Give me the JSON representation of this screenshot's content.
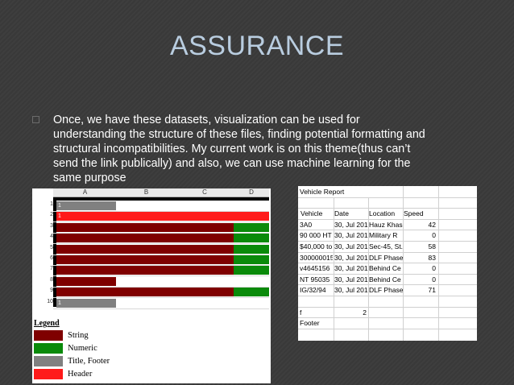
{
  "slide": {
    "title": "ASSURANCE",
    "bullet": "Once, we have these datasets, visualization can be used for understanding the structure of these files, finding potential formatting and structural incompatibilities. My current work is on this theme(thus can’t send the link publically) and also, we can use machine learning for the same purpose"
  },
  "sheet": {
    "columns": [
      "A",
      "B",
      "C",
      "D"
    ],
    "rows": [
      {
        "num": "1",
        "cell": "1",
        "type": "title"
      },
      {
        "num": "2",
        "cell": "1",
        "type": "header"
      },
      {
        "num": "3",
        "cell": "",
        "type": "string-numeric"
      },
      {
        "num": "4",
        "cell": "",
        "type": "string-numeric"
      },
      {
        "num": "5",
        "cell": "",
        "type": "string-numeric"
      },
      {
        "num": "6",
        "cell": "",
        "type": "string-numeric"
      },
      {
        "num": "7",
        "cell": "",
        "type": "string-numeric"
      },
      {
        "num": "8",
        "cell": "",
        "type": "string-short"
      },
      {
        "num": "9",
        "cell": "",
        "type": "string-numeric"
      },
      {
        "num": "10",
        "cell": "1",
        "type": "title"
      }
    ],
    "legend": {
      "title": "Legend",
      "items": [
        {
          "label": "String",
          "color": "#7f0000"
        },
        {
          "label": "Numeric",
          "color": "#0a8a0a"
        },
        {
          "label": "Title, Footer",
          "color": "#808080"
        },
        {
          "label": "Header",
          "color": "#ff1a1a"
        }
      ]
    }
  },
  "report": {
    "title": "Vehicle Report",
    "headers": [
      "Vehicle",
      "Date",
      "Location",
      "Speed"
    ],
    "rows": [
      [
        "3A0",
        "30, Jul 201",
        "Hauz Khas",
        "42"
      ],
      [
        "90 000 HT",
        "30, Jul 201",
        "Military R",
        "0"
      ],
      [
        "$40,000 to",
        "30, Jul 201",
        "Sec-45, St.",
        "58"
      ],
      [
        "300000015",
        "30, Jul 201",
        "DLF Phase",
        "83"
      ],
      [
        "v4645156",
        "30, Jul 201",
        "Behind Ce",
        "0"
      ],
      [
        "NT 95035",
        "30, Jul 201",
        "Behind Ce",
        "0"
      ],
      [
        "IG/32/94",
        "30, Jul 201",
        "DLF Phase",
        "71"
      ]
    ],
    "footer_row": [
      "f",
      "2"
    ],
    "footer": "Footer"
  }
}
